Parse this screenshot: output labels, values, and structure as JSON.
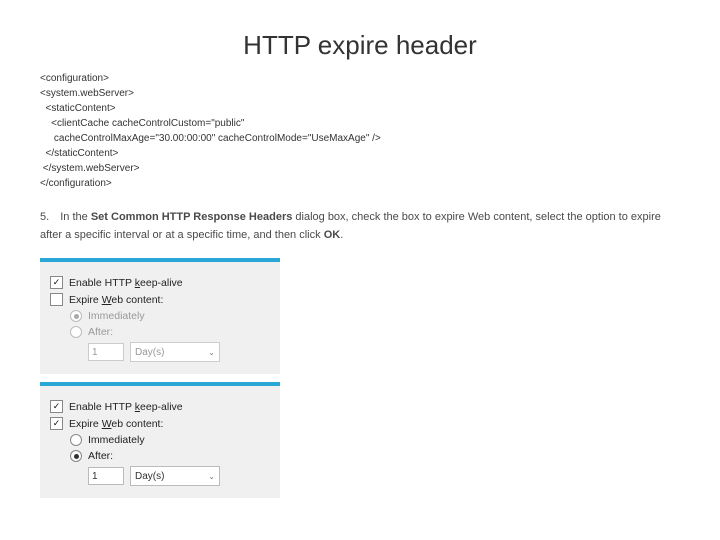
{
  "title": "HTTP expire header",
  "code": "<configuration>\n<system.webServer>\n  <staticContent>\n    <clientCache cacheControlCustom=\"public\"\n     cacheControlMaxAge=\"30.00:00:00\" cacheControlMode=\"UseMaxAge\" />\n  </staticContent>\n </system.webServer>\n</configuration>",
  "step": {
    "num": "5.",
    "pre": "In the ",
    "bold1": "Set Common HTTP Response Headers",
    "mid": " dialog box, check the box to expire Web content, select the option to expire after a specific interval or at a specific time, and then click ",
    "bold2": "OK",
    "end": "."
  },
  "panel1": {
    "keepalive": "Enable HTTP keep-alive",
    "expire": "Expire Web content:",
    "immediately": "Immediately",
    "after": "After:",
    "value": "1",
    "unit": "Day(s)"
  },
  "panel2": {
    "keepalive": "Enable HTTP keep-alive",
    "expire": "Expire Web content:",
    "immediately": "Immediately",
    "after": "After:",
    "value": "1",
    "unit": "Day(s)"
  }
}
